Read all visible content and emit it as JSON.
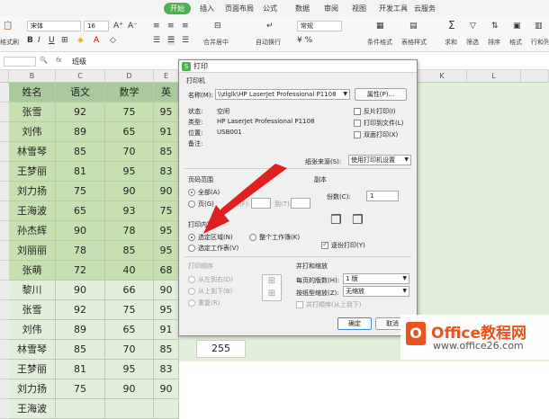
{
  "menubar": {
    "tabs": [
      "开始",
      "插入",
      "页面布局",
      "公式",
      "数据",
      "审阅",
      "视图",
      "开发工具",
      "云服务"
    ],
    "active_tab": "开始"
  },
  "ribbon": {
    "font_name": "宋体",
    "font_size": "16",
    "paste_label": "粘贴",
    "format_painter_label": "格式刷",
    "merge_label": "合并居中",
    "wrap_label": "自动换行",
    "number_format": "常规",
    "conditional_label": "条件格式",
    "table_style_label": "表格样式",
    "sum_label": "求和",
    "filter_label": "筛选",
    "sort_label": "排序",
    "format_label": "格式",
    "rowcol_label": "行和列"
  },
  "formula_bar": {
    "fx_label": "fx",
    "content": "班级"
  },
  "grid": {
    "col_headers": [
      "B",
      "C",
      "D",
      "E",
      "K",
      "L"
    ],
    "header_row": [
      "姓名",
      "语文",
      "数学",
      "英"
    ],
    "rows": [
      [
        "张雪",
        "92",
        "75",
        "95"
      ],
      [
        "刘伟",
        "89",
        "65",
        "91"
      ],
      [
        "林雪琴",
        "85",
        "70",
        "85"
      ],
      [
        "王梦丽",
        "81",
        "95",
        "83"
      ],
      [
        "刘力扬",
        "75",
        "90",
        "90"
      ],
      [
        "王海波",
        "65",
        "93",
        "75"
      ],
      [
        "孙杰辉",
        "90",
        "78",
        "95"
      ],
      [
        "刘丽丽",
        "78",
        "85",
        "95"
      ],
      [
        "张萌",
        "72",
        "40",
        "68"
      ],
      [
        "黎川",
        "90",
        "66",
        "90"
      ],
      [
        "张雪",
        "92",
        "75",
        "95"
      ],
      [
        "刘伟",
        "89",
        "65",
        "91"
      ],
      [
        "林雪琴",
        "85",
        "70",
        "85"
      ],
      [
        "王梦丽",
        "81",
        "95",
        "83"
      ],
      [
        "刘力扬",
        "75",
        "90",
        "90"
      ],
      [
        "王海波",
        "",
        "",
        ""
      ]
    ],
    "extra_value": "255"
  },
  "dialog": {
    "title": "打印",
    "printer_section": "打印机",
    "name_label": "名称(M):",
    "printer_name": "\\\\zlglk\\HP LaserJet Professional P1108",
    "properties_button": "属性(P)...",
    "status_label": "状态:",
    "status_value": "空闲",
    "type_label": "类型:",
    "type_value": "HP LaserJet Professional P1108",
    "location_label": "位置:",
    "location_value": "USB001",
    "note_label": "备注:",
    "reverse_print": "反片打印(I)",
    "print_to_file": "打印到文件(L)",
    "duplex_print": "双面打印(X)",
    "paper_source_label": "纸张来源(S):",
    "paper_source_value": "使用打印机设置",
    "page_range_section": "页码范围",
    "all_pages": "全部(A)",
    "pages": "页(G)",
    "from_label": "从(F):",
    "to_label": "到(T):",
    "copies_section": "副本",
    "copies_label": "份数(C):",
    "copies_value": "1",
    "print_content_section": "打印内容",
    "selection": "选定区域(N)",
    "whole_workbook": "整个工作簿(K)",
    "selected_sheets": "选定工作表(V)",
    "collate": "逐份打印(Y)",
    "print_order_section": "打印顺序",
    "left_to_right": "从左到右(D)",
    "top_to_bottom": "从上到下(B)",
    "repeat": "重复(R)",
    "merge_zoom_section": "并打和缩放",
    "pages_per_sheet_label": "每页的版数(H):",
    "pages_per_sheet_value": "1 版",
    "scale_label": "按纸型缩放(Z):",
    "scale_value": "无缩放",
    "merge_top_to_bottom": "并打顺序(从上到下)",
    "ok_button": "确定",
    "cancel_button": "取消"
  },
  "watermark": {
    "brand": "Office教程网",
    "url": "www.office26.com"
  },
  "colors": {
    "green_header": "#a9c99e",
    "green_data": "#c6e0b4",
    "green_light": "#e2efda",
    "arrow": "#e02020",
    "accent": "#4caf50"
  }
}
